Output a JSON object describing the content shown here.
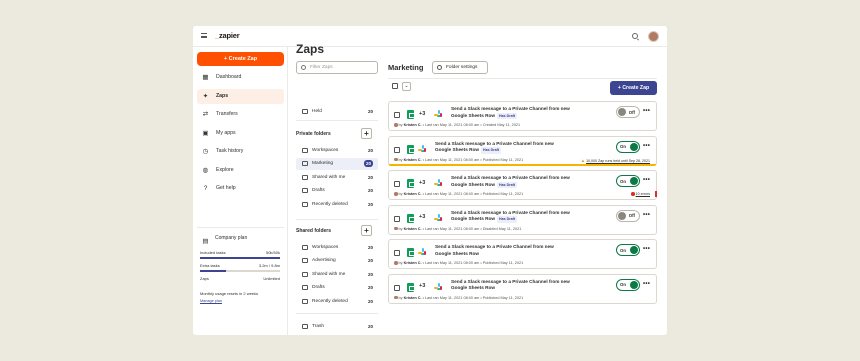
{
  "app": {
    "logo_text": "zapier"
  },
  "nav": {
    "create_label": "+ Create Zap",
    "items": [
      {
        "label": "Dashboard",
        "icon": "dashboard-icon",
        "glyph": "▦",
        "active": false
      },
      {
        "label": "Zaps",
        "icon": "zap-icon",
        "glyph": "✦",
        "active": true
      },
      {
        "label": "Transfers",
        "icon": "transfers-icon",
        "glyph": "⇄",
        "active": false
      },
      {
        "label": "My apps",
        "icon": "apps-icon",
        "glyph": "▣",
        "active": false
      },
      {
        "label": "Task history",
        "icon": "history-icon",
        "glyph": "◷",
        "active": false
      },
      {
        "label": "Explore",
        "icon": "explore-icon",
        "glyph": "◍",
        "active": false
      },
      {
        "label": "Get help",
        "icon": "help-icon",
        "glyph": "?",
        "active": false
      }
    ],
    "plan": {
      "label": "Company plan",
      "rows": [
        {
          "label": "Included tasks",
          "value": "50k/50k",
          "bar": 1.0
        },
        {
          "label": "Extra tasks",
          "value": "3.2m / 9.8m",
          "bar": 0.33
        },
        {
          "label": "Zaps",
          "value": "Unlimited",
          "bar": null
        }
      ],
      "note": "Monthly usage resets in 2 weeks",
      "manage": "Manage plan"
    }
  },
  "folders": {
    "heading": "Zaps",
    "filter_placeholder": "Filter Zaps",
    "top_item": {
      "label": "Held",
      "count": "20"
    },
    "private_title": "Private folders",
    "private": [
      {
        "label": "Workspaces",
        "count": "20",
        "selected": false
      },
      {
        "label": "Marketing",
        "count": "20",
        "selected": true
      },
      {
        "label": "Shared with me",
        "count": "20",
        "selected": false
      },
      {
        "label": "Drafts",
        "count": "20",
        "selected": false
      },
      {
        "label": "Recently deleted",
        "count": "20",
        "selected": false
      }
    ],
    "shared_title": "Shared folders",
    "shared": [
      {
        "label": "Workspaces",
        "count": "20"
      },
      {
        "label": "Advertising",
        "count": "20"
      },
      {
        "label": "Shared with me",
        "count": "20"
      },
      {
        "label": "Drafts",
        "count": "20"
      },
      {
        "label": "Recently deleted",
        "count": "20"
      }
    ],
    "trash": {
      "label": "Trash",
      "count": "20"
    }
  },
  "main": {
    "title": "Marketing",
    "folder_settings": "Folder settings",
    "create_zap": "+ Create Zap",
    "zaps": [
      {
        "title": "Send a Slack message to a Private Channel from new Google Sheets Row",
        "badge": "Has Draft",
        "plus": "+3",
        "state": "Off",
        "on": false,
        "owner": "Kristen C.",
        "meta": " • Last ran May 11, 2021 08:00 am • Created May 11, 2021",
        "status": "",
        "status_kind": "none"
      },
      {
        "title": "Send a Slack message to a Private Channel from new Google Sheets Row",
        "badge": "Has Draft",
        "plus": "",
        "state": "On",
        "on": true,
        "owner": "Kristen C.",
        "meta": " • Last ran May 11, 2021 08:00 am • Published May 11, 2021",
        "status": "10,000 Zap runs held until Sep 28, 2021",
        "status_kind": "warn"
      },
      {
        "title": "Send a Slack message to a Private Channel from new Google Sheets Row",
        "badge": "Has Draft",
        "plus": "+3",
        "state": "On",
        "on": true,
        "owner": "Kristen C.",
        "meta": " • Last ran May 11, 2021 08:00 am • Published May 11, 2021",
        "status": "10 errors",
        "status_kind": "error"
      },
      {
        "title": "Send a Slack message to a Private Channel from new Google Sheets Row",
        "badge": "Has Draft",
        "plus": "+3",
        "state": "Off",
        "on": false,
        "owner": "Kristen C.",
        "meta": " • Last ran May 11, 2021 08:00 am • Disabled May 11, 2021",
        "status": "",
        "status_kind": "none"
      },
      {
        "title": "Send a Slack message to a Private Channel from new Google Sheets Row",
        "badge": "",
        "plus": "",
        "state": "On",
        "on": true,
        "owner": "Kristen C.",
        "meta": " • Last ran May 11, 2021 08:00 am • Published May 11, 2021",
        "status": "",
        "status_kind": "none"
      },
      {
        "title": "Send a Slack message to a Private Channel from new Google Sheets Row",
        "badge": "",
        "plus": "+3",
        "state": "On",
        "on": true,
        "owner": "Kristen C.",
        "meta": " • Last ran May 11, 2021 08:00 am • Published May 11, 2021",
        "status": "",
        "status_kind": "none"
      }
    ]
  },
  "colors": {
    "brand_orange": "#ff4f00",
    "accent_navy": "#3d4592",
    "on_green": "#0b7a45",
    "warning": "#f4b400",
    "error": "#d93025"
  }
}
